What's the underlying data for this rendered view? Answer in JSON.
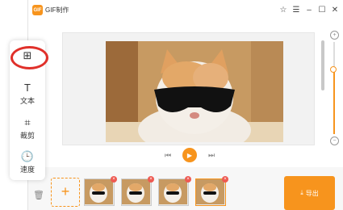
{
  "app": {
    "title": "GIF制作",
    "logo_text": "GIF"
  },
  "window_controls": [
    "☆",
    "☰",
    "–",
    "☐",
    "✕"
  ],
  "toolbox": {
    "items": [
      {
        "icon": "add-frame-icon",
        "glyph": "⊞",
        "label": ""
      },
      {
        "icon": "text-icon",
        "glyph": "T",
        "label": "文本"
      },
      {
        "icon": "crop-icon",
        "glyph": "⌗",
        "label": "裁剪"
      },
      {
        "icon": "clock-icon",
        "glyph": "🕒",
        "label": "速度"
      }
    ]
  },
  "playback": {
    "prev": "⏮",
    "play": "▶",
    "next": "⏭"
  },
  "zoom": {
    "level": 0.7
  },
  "bottom": {
    "add_label": "+",
    "export_label": "导出",
    "frame_count": 4,
    "active_frame": 4
  },
  "colors": {
    "accent": "#f7941d",
    "delete": "#ee5a52",
    "highlight": "#e0302a"
  }
}
